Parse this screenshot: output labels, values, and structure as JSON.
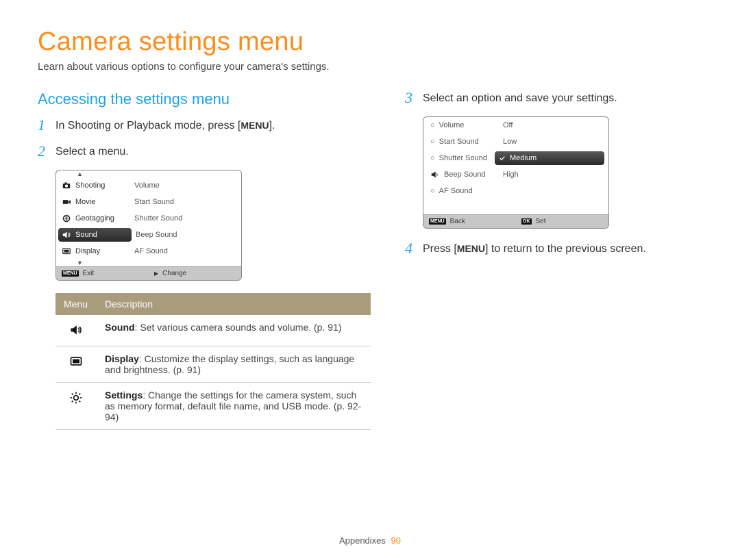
{
  "page": {
    "title": "Camera settings menu",
    "intro": "Learn about various options to configure your camera's settings.",
    "section_title": "Accessing the settings menu"
  },
  "steps": {
    "s1_pre": "In Shooting or Playback mode, press [",
    "s1_menu": "MENU",
    "s1_post": "].",
    "s2": "Select a menu.",
    "s3": "Select an option and save your settings.",
    "s4_pre": "Press [",
    "s4_menu": "MENU",
    "s4_post": "] to return to the previous screen."
  },
  "step_nums": {
    "one": "1",
    "two": "2",
    "three": "3",
    "four": "4"
  },
  "cam1": {
    "left": [
      "Shooting",
      "Movie",
      "Geotagging",
      "Sound",
      "Display"
    ],
    "right": [
      "Volume",
      "Start Sound",
      "Shutter Sound",
      "Beep Sound",
      "AF Sound"
    ],
    "footer_left_tag": "MENU",
    "footer_left": "Exit",
    "footer_right": "Change"
  },
  "table": {
    "h1": "Menu",
    "h2": "Description",
    "rows": [
      {
        "bold": "Sound",
        "text": ": Set various camera sounds and volume. (p. 91)"
      },
      {
        "bold": "Display",
        "text": ": Customize the display settings, such as language and brightness. (p. 91)"
      },
      {
        "bold": "Settings",
        "text": ": Change the settings for the camera system, such as memory format, default file name, and USB mode. (p. 92-94)"
      }
    ]
  },
  "cam2": {
    "left": [
      "Volume",
      "Start Sound",
      "Shutter Sound",
      "Beep Sound",
      "AF Sound"
    ],
    "right": [
      "Off",
      "Low",
      "Medium",
      "High"
    ],
    "footer_left_tag": "MENU",
    "footer_left": "Back",
    "footer_right_tag": "OK",
    "footer_right": "Set"
  },
  "footer": {
    "section": "Appendixes",
    "page": "90"
  }
}
